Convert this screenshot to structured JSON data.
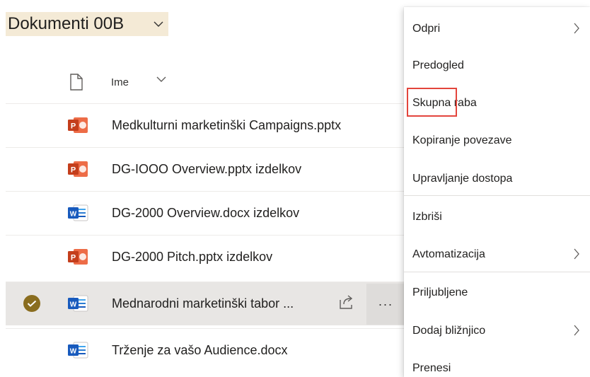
{
  "library": {
    "title": "Dokumenti 00B"
  },
  "columns": {
    "name": "Ime"
  },
  "files": [
    {
      "name": "Medkulturni marketinški Campaigns.pptx",
      "type": "pptx",
      "selected": false
    },
    {
      "name": "DG-IOOO Overview.pptx izdelkov",
      "type": "pptx",
      "selected": false
    },
    {
      "name": "DG-2000 Overview.docx izdelkov",
      "type": "docx",
      "selected": false
    },
    {
      "name": "DG-2000 Pitch.pptx izdelkov",
      "type": "pptx",
      "selected": false
    },
    {
      "name": "Mednarodni marketinški tabor ...",
      "type": "docx",
      "selected": true
    },
    {
      "name": "Trženje za vašo Audience.docx",
      "type": "docx",
      "selected": false
    }
  ],
  "row_actions": {
    "more": "···"
  },
  "context_menu": {
    "items": [
      {
        "label": "Odpri",
        "submenu": true
      },
      {
        "label": "Predogled",
        "submenu": false
      },
      {
        "label": "Skupna raba",
        "submenu": false,
        "highlighted": true
      },
      {
        "label": "Kopiranje povezave",
        "submenu": false
      },
      {
        "label": "Upravljanje dostopa",
        "submenu": false
      },
      {
        "label": "Izbriši",
        "submenu": false
      },
      {
        "label": "Avtomatizacija",
        "submenu": true
      },
      {
        "label": "Priljubljene",
        "submenu": false
      },
      {
        "label": "Dodaj bližnjico",
        "submenu": true
      },
      {
        "label": "Prenesi",
        "submenu": false
      }
    ]
  },
  "colors": {
    "title_bg": "#f4ead6",
    "check": "#8a6d1f",
    "ppt": "#c43e1c",
    "word": "#185abd",
    "highlight": "#e3453c"
  }
}
